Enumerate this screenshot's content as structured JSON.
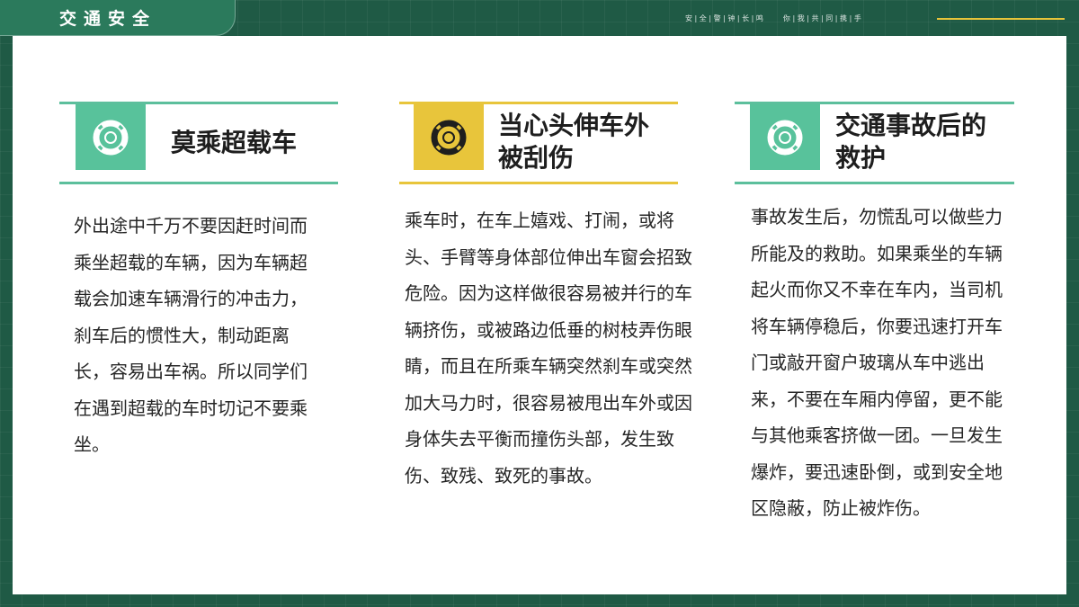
{
  "header": {
    "title": "交通安全",
    "slogan_left": [
      "安",
      "全",
      "警",
      "钟",
      "长",
      "鸣"
    ],
    "slogan_right": [
      "你",
      "我",
      "共",
      "同",
      "携",
      "手"
    ]
  },
  "colors": {
    "background": "#1f5a45",
    "tab": "#2b7a5c",
    "green_accent": "#58c29b",
    "yellow_accent": "#e8c53b",
    "slogan_line": "#e7c43a"
  },
  "cards": [
    {
      "icon": "lifebuoy-icon",
      "title": "莫乘超载车",
      "body": "外出途中千万不要因赶时间而乘坐超载的车辆，因为车辆超载会加速车辆滑行的冲击力，刹车后的惯性大，制动距离长，容易出车祸。所以同学们在遇到超载的车时切记不要乘坐。"
    },
    {
      "icon": "lifebuoy-icon",
      "title_line1": "当心头伸车外",
      "title_line2": "被刮伤",
      "body": "乘车时，在车上嬉戏、打闹，或将头、手臂等身体部位伸出车窗会招致危险。因为这样做很容易被并行的车辆挤伤，或被路边低垂的树枝弄伤眼睛，而且在所乘车辆突然刹车或突然加大马力时，很容易被甩出车外或因身体失去平衡而撞伤头部，发生致伤、致残、致死的事故。"
    },
    {
      "icon": "lifebuoy-icon",
      "title_line1": "交通事故后的",
      "title_line2": "救护",
      "body": "事故发生后，勿慌乱可以做些力所能及的救助。如果乘坐的车辆起火而你又不幸在车内，当司机将车辆停稳后，你要迅速打开车门或敲开窗户玻璃从车中逃出来，不要在车厢内停留，更不能与其他乘客挤做一团。一旦发生爆炸，要迅速卧倒，或到安全地区隐蔽，防止被炸伤。"
    }
  ]
}
